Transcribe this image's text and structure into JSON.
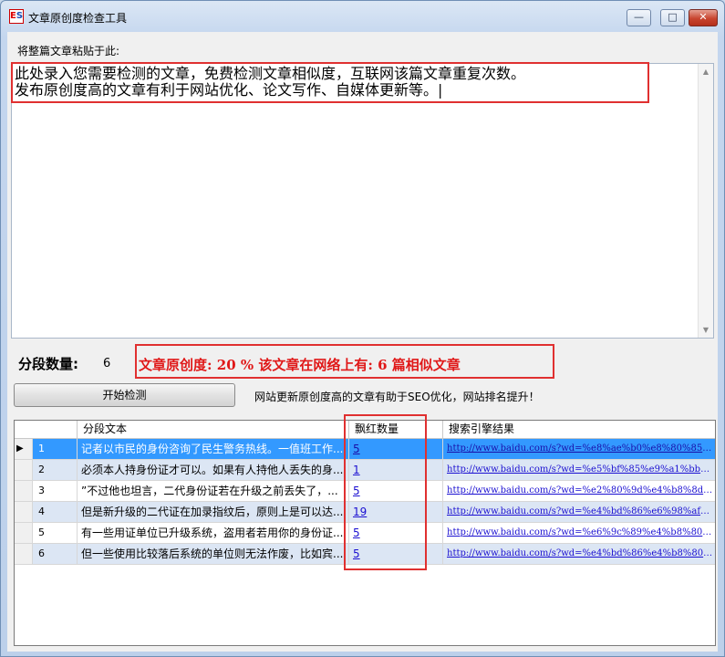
{
  "window": {
    "title": "文章原创度检查工具",
    "icon_text": "ES",
    "minimize": "—",
    "maximize": "□",
    "close": "✕"
  },
  "editor": {
    "label": "将整篇文章粘贴于此:",
    "line1": "此处录入您需要检测的文章，免费检测文章相似度，互联网该篇文章重复次数。",
    "line2": "发布原创度高的文章有利于网站优化、论文写作、自媒体更新等。|"
  },
  "summary": {
    "segment_label": "分段数量:",
    "segment_count": "6",
    "result": "文章原创度: 20 %  该文章在网络上有: 6 篇相似文章"
  },
  "actions": {
    "start_label": "开始检测",
    "promo": "网站更新原创度高的文章有助于SEO优化，网站排名提升！"
  },
  "table": {
    "columns": [
      "分段文本",
      "飘红数量",
      "搜索引擎结果"
    ],
    "rows": [
      {
        "num": "1",
        "text": "记者以市民的身份咨询了民生警务热线。一值班工作...",
        "count": "5",
        "link": "http://www.baidu.com/s?wd=%e8%ae%b0%e8%80%85%e..."
      },
      {
        "num": "2",
        "text": "必须本人持身份证才可以。如果有人持他人丢失的身...",
        "count": "1",
        "link": "http://www.baidu.com/s?wd=%e5%bf%85%e9%a1%bb%e..."
      },
      {
        "num": "3",
        "text": "”不过他也坦言，二代身份证若在升级之前丢失了，...",
        "count": "5",
        "link": "http://www.baidu.com/s?wd=%e2%80%9d%e4%b8%8d%e..."
      },
      {
        "num": "4",
        "text": "但是新升级的二代证在加录指纹后，原则上是可以达...",
        "count": "19",
        "link": "http://www.baidu.com/s?wd=%e4%bd%86%e6%98%af%e..."
      },
      {
        "num": "5",
        "text": "有一些用证单位已升级系统，盗用者若用你的身份证...",
        "count": "5",
        "link": "http://www.baidu.com/s?wd=%e6%9c%89%e4%b8%80%e..."
      },
      {
        "num": "6",
        "text": "但一些使用比较落后系统的单位则无法作废，比如宾...",
        "count": "5",
        "link": "http://www.baidu.com/s?wd=%e4%bd%86%e4%b8%80%e..."
      }
    ]
  },
  "colors": {
    "accent_red": "#e01818",
    "selection": "#3399ff",
    "alt_row": "#dce6f4"
  }
}
